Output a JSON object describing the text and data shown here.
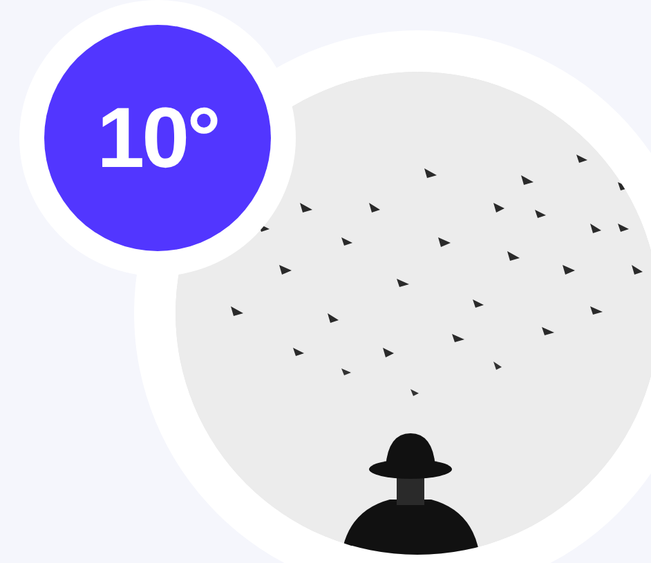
{
  "badge": {
    "text": "10°"
  }
}
